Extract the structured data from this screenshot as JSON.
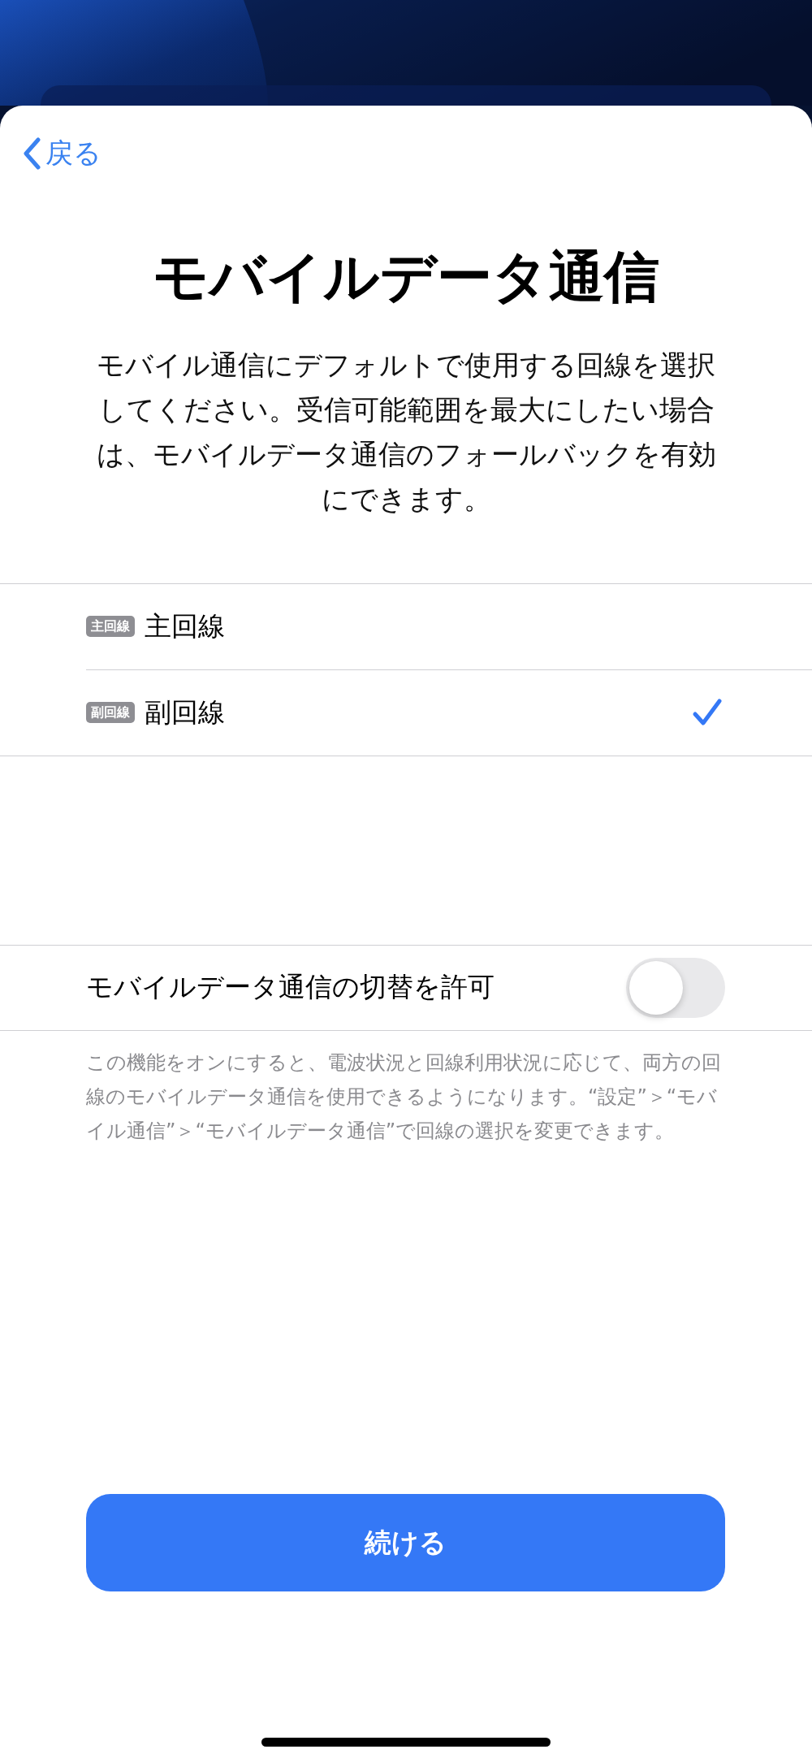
{
  "nav": {
    "back": "戻る"
  },
  "title": "モバイルデータ通信",
  "description": "モバイル通信にデフォルトで使用する回線を選択してください。受信可能範囲を最大にしたい場合は、モバイルデータ通信のフォールバックを有効にできます。",
  "lines": [
    {
      "badge": "主回線",
      "label": "主回線",
      "selected": false
    },
    {
      "badge": "副回線",
      "label": "副回線",
      "selected": true
    }
  ],
  "switch_row": {
    "label": "モバイルデータ通信の切替を許可",
    "on": false
  },
  "footnote": "この機能をオンにすると、電波状況と回線利用状況に応じて、両方の回線のモバイルデータ通信を使用できるようになります。“設定”＞“モバイル通信”＞“モバイルデータ通信”で回線の選択を変更できます。",
  "continue_button": "続ける"
}
